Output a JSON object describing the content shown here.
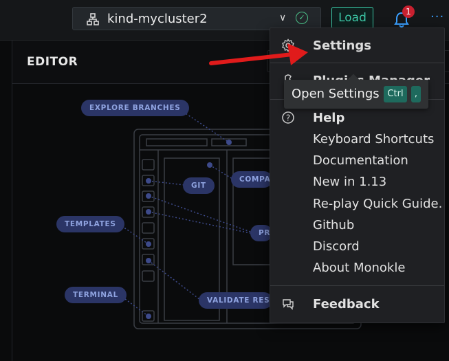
{
  "topbar": {
    "cluster_name": "kind-mycluster2",
    "load_label": "Load",
    "notification_count": "1",
    "more_label": "···"
  },
  "editor": {
    "title": "EDITOR"
  },
  "illustration": {
    "labels": {
      "explore_branches": "EXPLORE BRANCHES",
      "git": "GIT",
      "compare": "COMPA",
      "templates": "TEMPLATES",
      "preview": "PR",
      "terminal": "TERMINAL",
      "validate": "VALIDATE RESOU"
    }
  },
  "menu": {
    "settings": "Settings",
    "plugins_manager": "Plugins Manager",
    "help": "Help",
    "keyboard_shortcuts": "Keyboard Shortcuts",
    "documentation": "Documentation",
    "new_in": "New in 1.13",
    "replay_guide": "Re-play Quick Guide.",
    "github": "Github",
    "discord": "Discord",
    "about": "About Monokle",
    "feedback": "Feedback"
  },
  "tooltip": {
    "text": "Open Settings",
    "key_ctrl": "Ctrl",
    "key_comma": ","
  },
  "colors": {
    "accent": "#3cc7a6",
    "pill_bg": "#2b3566",
    "pill_text": "#8fa3e0",
    "badge": "#c8202f",
    "annotation_arrow": "#e01b1b"
  }
}
